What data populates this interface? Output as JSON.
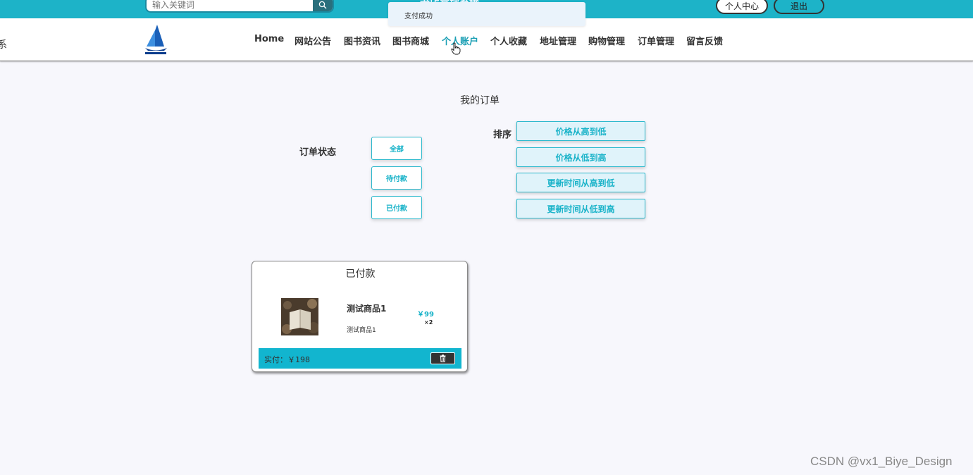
{
  "topbar": {
    "search_placeholder": "输入关键词",
    "search_icon": "search-icon",
    "title_fragment": "书店管理系统",
    "personal_center": "个人中心",
    "logout": "退出"
  },
  "toast": {
    "message": "支付成功"
  },
  "nav": {
    "left_fragment": "系",
    "logo_icon": "sailboat-logo",
    "items": [
      {
        "label": "Home",
        "active": false
      },
      {
        "label": "网站公告",
        "active": false
      },
      {
        "label": "图书资讯",
        "active": false
      },
      {
        "label": "图书商城",
        "active": false
      },
      {
        "label": "个人账户",
        "active": true
      },
      {
        "label": "个人收藏",
        "active": false
      },
      {
        "label": "地址管理",
        "active": false
      },
      {
        "label": "购物管理",
        "active": false
      },
      {
        "label": "订单管理",
        "active": false
      },
      {
        "label": "留言反馈",
        "active": false
      }
    ]
  },
  "page": {
    "title": "我的订单",
    "status_label": "订单状态",
    "status_buttons": [
      "全部",
      "待付款",
      "已付款"
    ],
    "sort_label": "排序",
    "sort_buttons": [
      "价格从高到低",
      "价格从低到高",
      "更新时间从高到低",
      "更新时间从低到高"
    ]
  },
  "order": {
    "status": "已付款",
    "product_name": "测试商品1",
    "product_desc": "测试商品1",
    "price": "￥99",
    "quantity": "×2",
    "paid": "实付：￥198",
    "delete_icon": "trash-icon"
  },
  "colors": {
    "accent": "#1db3c8",
    "background": "#f7f7fc"
  },
  "watermark": "CSDN @vx1_Biye_Design"
}
